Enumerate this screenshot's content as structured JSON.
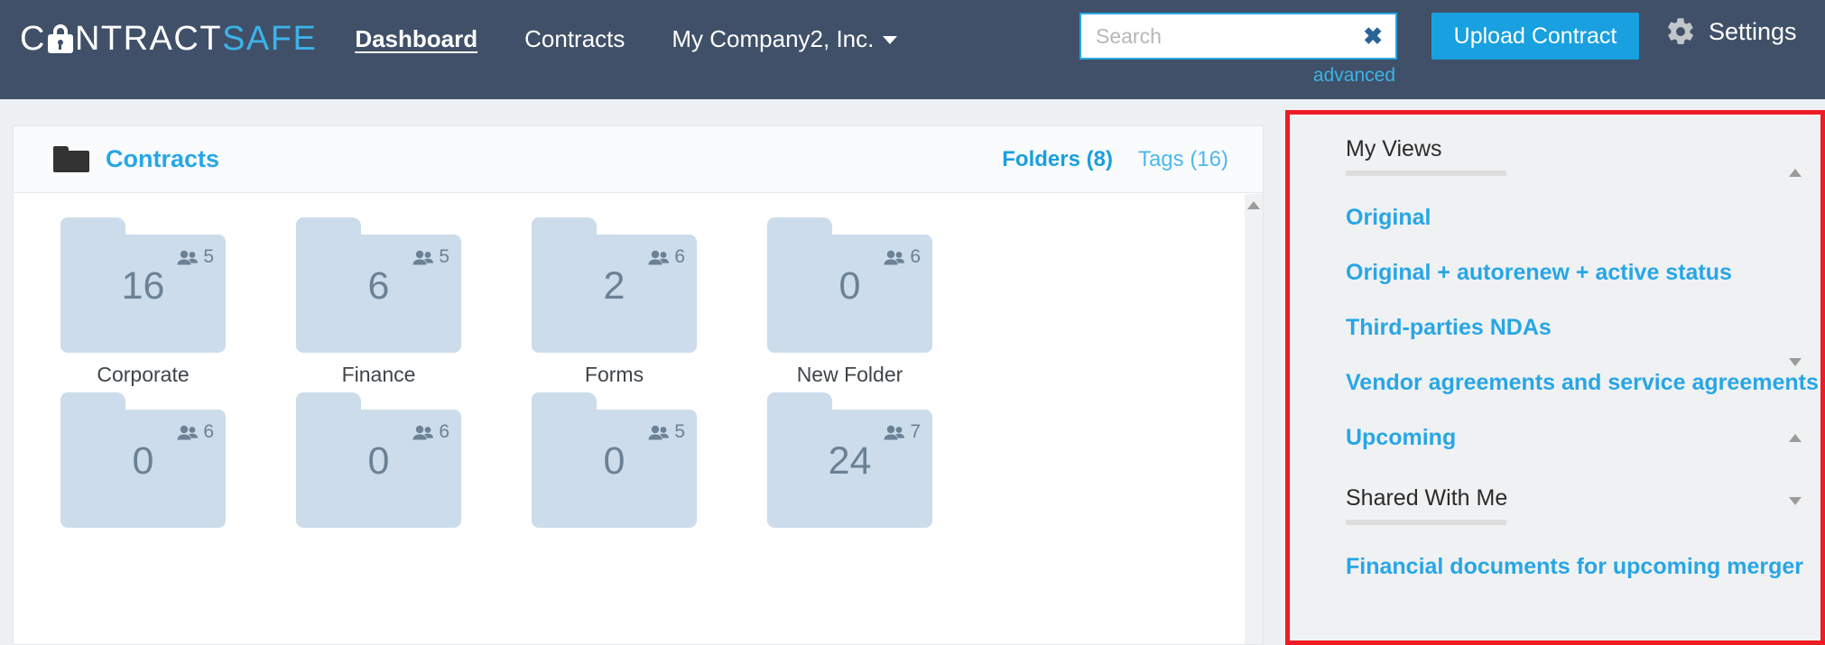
{
  "brand": {
    "name_part1": "C",
    "name_lock_icon": "lock-icon",
    "name_part2": "NTRACT",
    "name_part3": "SAFE",
    "accent_blue": "#27a6e5",
    "header_bg": "#405068",
    "folder_blue": "#ccdcea",
    "highlight_red": "#ee1c25"
  },
  "topnav": {
    "links": [
      {
        "label": "Dashboard",
        "active": true
      },
      {
        "label": "Contracts",
        "active": false
      }
    ],
    "company": {
      "label": "My Company2, Inc.",
      "caret_icon": "chevron-down-icon"
    },
    "search": {
      "value": "",
      "placeholder": "Search",
      "clear_icon": "close-icon",
      "clear_glyph": "✖",
      "advanced_label": "advanced"
    },
    "upload_label": "Upload Contract",
    "settings": {
      "label": "Settings",
      "icon": "gear-icon"
    }
  },
  "contracts_card": {
    "folder_icon": "folder-icon",
    "title": "Contracts",
    "tabs": [
      {
        "label": "Folders (8)",
        "active": true
      },
      {
        "label": "Tags (16)",
        "active": false
      }
    ],
    "folders": [
      {
        "name": "Corporate",
        "count": "16",
        "users": "5",
        "users_icon": "users-icon"
      },
      {
        "name": "Finance",
        "count": "6",
        "users": "5",
        "users_icon": "users-icon"
      },
      {
        "name": "Forms",
        "count": "2",
        "users": "6",
        "users_icon": "users-icon"
      },
      {
        "name": "New Folder",
        "count": "0",
        "users": "6",
        "users_icon": "users-icon"
      },
      {
        "name": "",
        "count": "0",
        "users": "6",
        "users_icon": "users-icon"
      },
      {
        "name": "",
        "count": "0",
        "users": "6",
        "users_icon": "users-icon"
      },
      {
        "name": "",
        "count": "0",
        "users": "5",
        "users_icon": "users-icon"
      },
      {
        "name": "",
        "count": "24",
        "users": "7",
        "users_icon": "users-icon"
      }
    ],
    "scrollbar": {
      "up_icon": "scroll-up-arrow-icon",
      "down_icon": "scroll-down-arrow-icon"
    }
  },
  "right_panel": {
    "my_views": {
      "heading": "My Views",
      "items": [
        {
          "label": "Original"
        },
        {
          "label": "Original + autorenew + active status"
        },
        {
          "label": "Third-parties NDAs"
        },
        {
          "label": "Vendor agreements and service agreements"
        },
        {
          "label": "Upcoming"
        }
      ],
      "scrollbar": {
        "up_icon": "scroll-up-arrow-icon",
        "down_icon": "scroll-down-arrow-icon"
      }
    },
    "shared_with_me": {
      "heading": "Shared With Me",
      "items": [
        {
          "label": "Financial documents for upcoming merger"
        }
      ],
      "scrollbar": {
        "up_icon": "scroll-up-arrow-icon",
        "down_icon": "scroll-down-arrow-icon"
      }
    }
  }
}
